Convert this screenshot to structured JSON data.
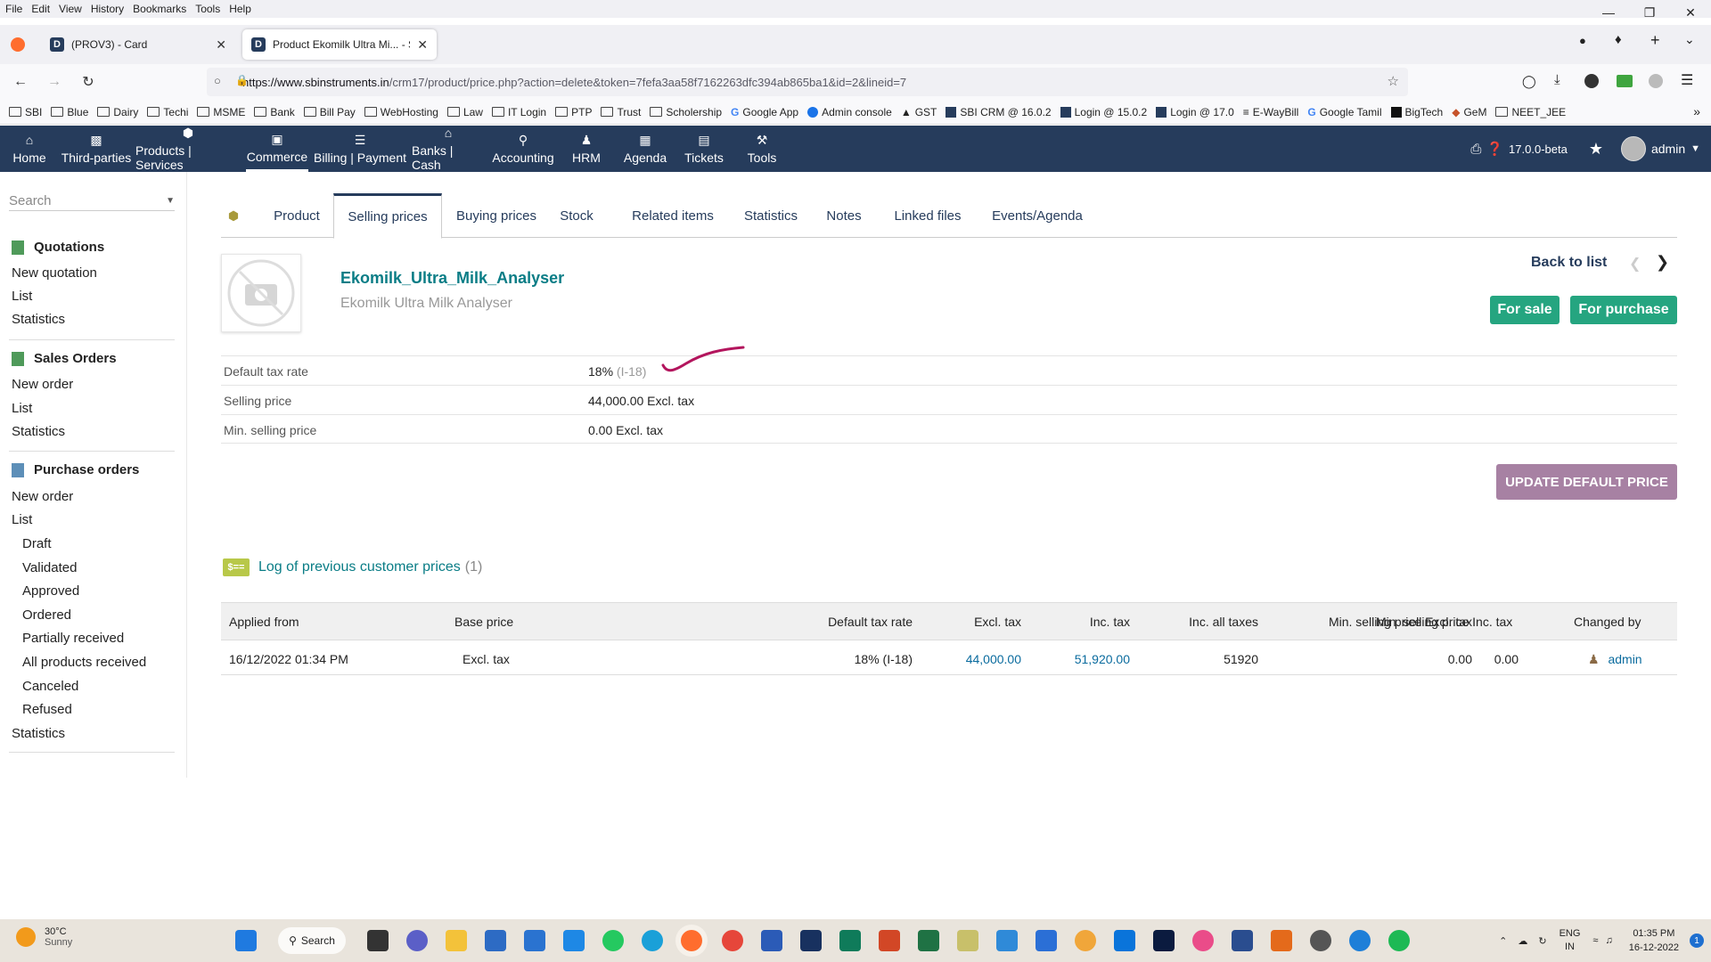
{
  "browser": {
    "menu": [
      "File",
      "Edit",
      "View",
      "History",
      "Bookmarks",
      "Tools",
      "Help"
    ],
    "tabs": [
      {
        "label": "(PROV3) - Card"
      },
      {
        "label": "Product Ekomilk Ultra Mi... - Se"
      }
    ],
    "url_host": "https://www.sbinstruments.in",
    "url_path": "/crm17/product/price.php?action=delete&token=7fefa3aa58f7162263dfc394ab865ba1&id=2&lineid=7",
    "bookmarks": [
      "SBI",
      "Blue",
      "Dairy",
      "Techi",
      "MSME",
      "Bank",
      "Bill Pay",
      "WebHosting",
      "Law",
      "IT Login",
      "PTP",
      "Trust",
      "Scholership",
      "Google App",
      "Admin console",
      "GST",
      "SBI CRM @ 16.0.2",
      "Login @ 15.0.2",
      "Login @ 17.0",
      "E-WayBill",
      "Google Tamil",
      "BigTech",
      "GeM",
      "NEET_JEE"
    ]
  },
  "appnav": {
    "items": [
      "Home",
      "Third-parties",
      "Products | Services",
      "Commerce",
      "Billing | Payment",
      "Banks | Cash",
      "Accounting",
      "HRM",
      "Agenda",
      "Tickets",
      "Tools"
    ],
    "version": "17.0.0-beta",
    "user": "admin"
  },
  "leftmenu": {
    "search_placeholder": "Search",
    "quotations": {
      "title": "Quotations",
      "items": [
        "New quotation",
        "List",
        "Statistics"
      ]
    },
    "sales_orders": {
      "title": "Sales Orders",
      "items": [
        "New order",
        "List",
        "Statistics"
      ]
    },
    "purchase_orders": {
      "title": "Purchase orders",
      "items": [
        "New order",
        "List",
        "Draft",
        "Validated",
        "Approved",
        "Ordered",
        "Partially received",
        "All products received",
        "Canceled",
        "Refused",
        "Statistics"
      ]
    }
  },
  "product_tabs": [
    "Product",
    "Selling prices",
    "Buying prices",
    "Stock",
    "Related items",
    "Statistics",
    "Notes",
    "Linked files",
    "Events/Agenda"
  ],
  "product": {
    "ref": "Ekomilk_Ultra_Milk_Analyser",
    "label": "Ekomilk Ultra Milk Analyser",
    "back_to_list": "Back to list",
    "status_sale": "For sale",
    "status_purchase": "For purchase"
  },
  "fields": [
    {
      "label": "Default tax rate",
      "value": "18%",
      "extra": "(I-18)"
    },
    {
      "label": "Selling price",
      "value": "44,000.00 Excl. tax",
      "extra": ""
    },
    {
      "label": "Min. selling price",
      "value": "0.00 Excl. tax",
      "extra": ""
    }
  ],
  "update_button": "UPDATE DEFAULT PRICE",
  "log": {
    "title": "Log of previous customer prices",
    "count": "(1)",
    "icon_text": "$==",
    "headers": [
      "Applied from",
      "Base price",
      "Default tax rate",
      "Excl. tax",
      "Inc. tax",
      "Inc. all taxes",
      "Min. selling price Excl. tax",
      "Min. selling price Inc. tax",
      "Changed by"
    ],
    "row": [
      "16/12/2022 01:34 PM",
      "Excl. tax",
      "18% (I-18)",
      "44,000.00",
      "51,920.00",
      "51920",
      "0.00",
      "0.00",
      "admin"
    ]
  },
  "taskbar": {
    "temp": "30°C",
    "weather": "Sunny",
    "search": "Search",
    "lang": "ENG",
    "region": "IN",
    "time": "01:35 PM",
    "date": "16-12-2022",
    "notif": "1"
  },
  "colors": {
    "accent": "#263c5c",
    "teal": "#0a7d86",
    "green": "#25a580",
    "purple": "#a781a3"
  }
}
